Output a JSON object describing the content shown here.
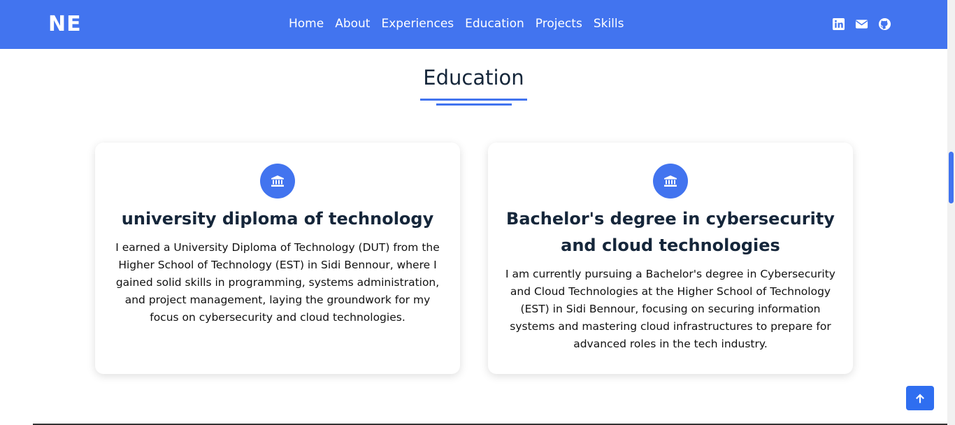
{
  "navbar": {
    "logo": "NE",
    "links": [
      {
        "label": "Home"
      },
      {
        "label": "About"
      },
      {
        "label": "Experiences"
      },
      {
        "label": "Education"
      },
      {
        "label": "Projects"
      },
      {
        "label": "Skills"
      }
    ],
    "social_icons": [
      "linkedin-icon",
      "envelope-icon",
      "github-icon"
    ]
  },
  "section": {
    "title": "Education"
  },
  "cards": [
    {
      "icon": "university-icon",
      "title": "university diploma of technology",
      "text": "I earned a University Diploma of Technology (DUT) from the Higher School of Technology (EST) in Sidi Bennour, where I gained solid skills in programming, systems administration, and project management, laying the groundwork for my focus on cybersecurity and cloud technologies."
    },
    {
      "icon": "university-icon",
      "title": "Bachelor's degree in cybersecurity and cloud technologies",
      "text": "I am currently pursuing a Bachelor's degree in Cybersecurity and Cloud Technologies at the Higher School of Technology (EST) in Sidi Bennour, focusing on securing information systems and mastering cloud infrastructures to prepare for advanced roles in the tech industry."
    }
  ],
  "back_to_top_icon": "arrow-up-icon",
  "colors": {
    "primary": "#4274ef",
    "heading": "#15263a"
  }
}
